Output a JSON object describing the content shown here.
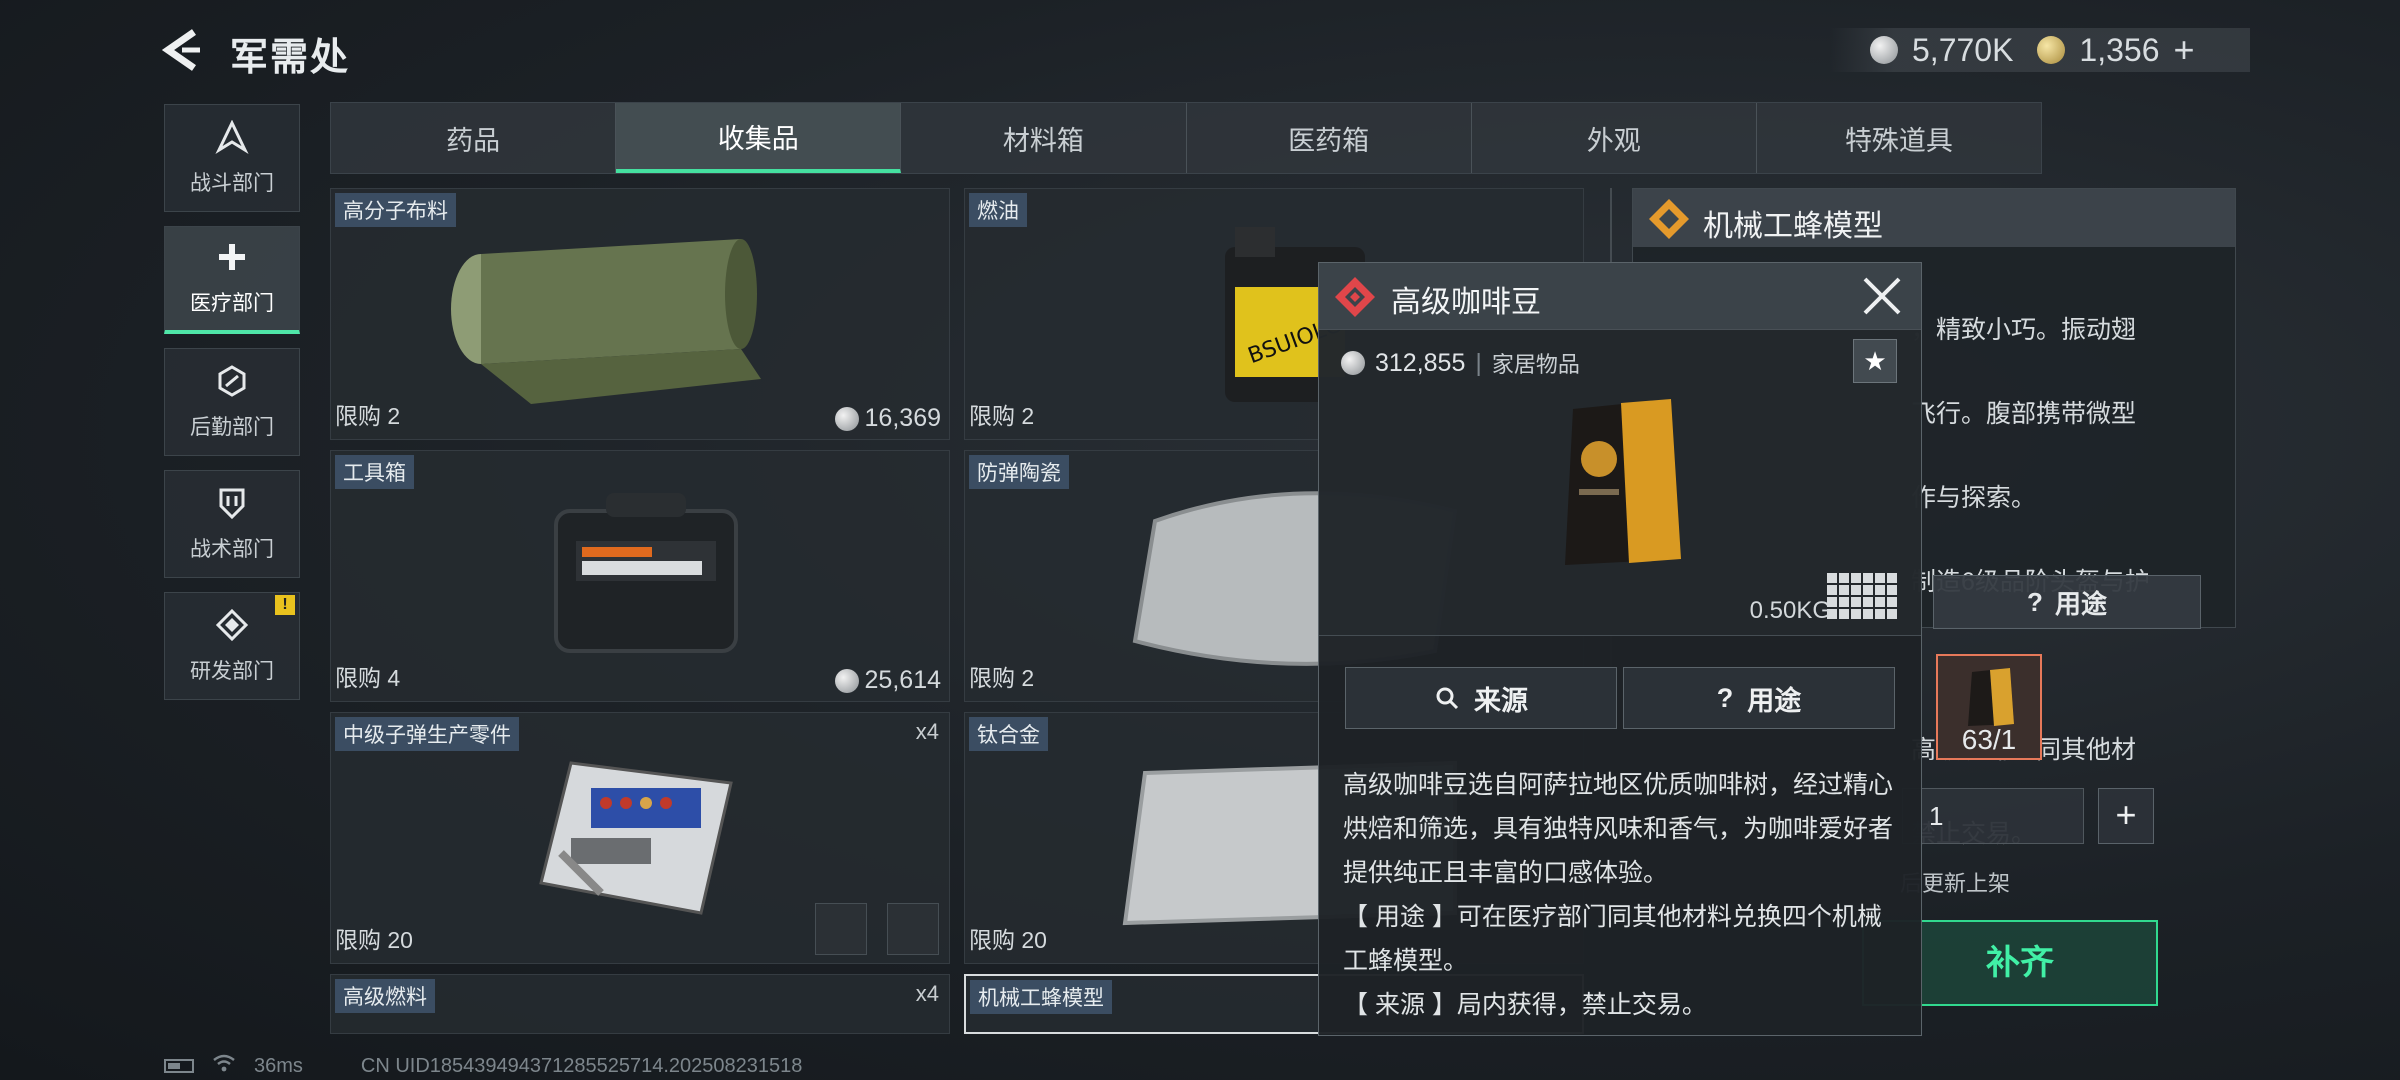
{
  "header": {
    "title": "军需处",
    "currency_silver": "5,770K",
    "currency_gold": "1,356",
    "currency_add": "+"
  },
  "sidebar": {
    "items": [
      {
        "label": "战斗部门",
        "icon": "combat-icon"
      },
      {
        "label": "医疗部门",
        "icon": "medical-icon",
        "active": true
      },
      {
        "label": "后勤部门",
        "icon": "logistics-icon"
      },
      {
        "label": "战术部门",
        "icon": "tactical-icon"
      },
      {
        "label": "研发部门",
        "icon": "research-icon",
        "badge": "!"
      }
    ]
  },
  "tabs": [
    "药品",
    "收集品",
    "材料箱",
    "医药箱",
    "外观",
    "特殊道具"
  ],
  "active_tab": "收集品",
  "items": [
    {
      "name": "高分子布料",
      "limit": "限购 2",
      "price": "16,369"
    },
    {
      "name": "燃油",
      "limit": "限购 2"
    },
    {
      "name": "工具箱",
      "limit": "限购 4",
      "price": "25,614"
    },
    {
      "name": "防弹陶瓷",
      "limit": "限购 2"
    },
    {
      "name": "中级子弹生产零件",
      "limit": "限购 20",
      "qty": "x4"
    },
    {
      "name": "钛合金",
      "limit": "限购 20"
    },
    {
      "name": "高级燃料",
      "qty": "x4"
    },
    {
      "name": "机械工蜂模型"
    }
  ],
  "detail": {
    "title": "机械工蜂模型",
    "text_lines": [
      "，精致小巧。振动翅",
      "飞行。腹部携带微型",
      "作与探索。",
      "制造6级品阶头盔与护",
      "",
      "高级咖啡豆同其他材",
      "禁止交易。"
    ],
    "usage_button": "用途",
    "thumb_count": "63/1",
    "quantity": "1",
    "plus": "+",
    "refresh_note": "后更新上架",
    "restock_button": "补齐"
  },
  "popup": {
    "title": "高级咖啡豆",
    "price": "312,855",
    "category": "家居物品",
    "weight": "0.50KG",
    "source_button": "来源",
    "usage_button": "用途",
    "description": [
      "高级咖啡豆选自阿萨拉地区优质咖啡树，经过精心烘焙和筛选，具有独特风味和香气，为咖啡爱好者提供纯正且丰富的口感体验。",
      "【 用途 】可在医疗部门同其他材料兑换四个机械工蜂模型。",
      "【 来源 】局内获得，禁止交易。"
    ]
  },
  "footer": {
    "ping": "36ms",
    "uid": "CN UID185439494371285525714.202508231518"
  },
  "colors": {
    "accent_green": "#45e0a0",
    "tag_blue": "#3b4d62",
    "popup_red": "#e0464a"
  }
}
